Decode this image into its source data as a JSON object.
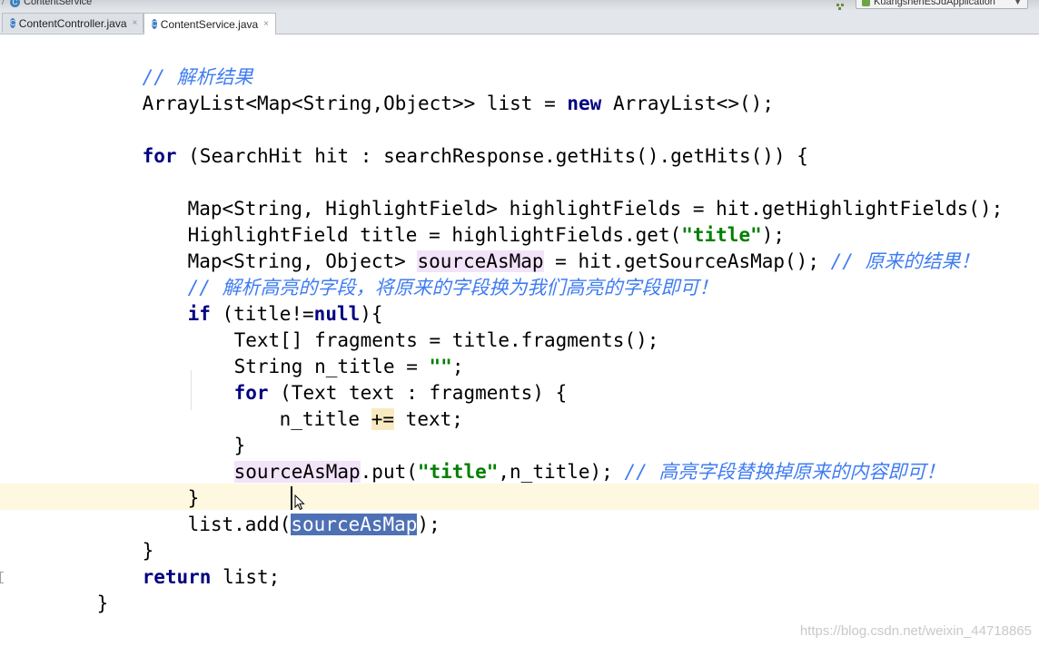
{
  "breadcrumb": {
    "items": [
      "ContentService"
    ],
    "run_config": "KuangshenEsJdApplication"
  },
  "tabs": [
    {
      "label": "ContentController.java",
      "active": false
    },
    {
      "label": "ContentService.java",
      "active": true
    }
  ],
  "code": {
    "lines": [
      [
        "// 解析结果"
      ],
      [
        "ArrayList<Map<String,Object>> list = ",
        "new",
        " ArrayList<>();"
      ],
      [
        ""
      ],
      [
        "for",
        " (SearchHit hit : searchResponse.getHits().getHits()) {"
      ],
      [
        ""
      ],
      [
        "Map<String, HighlightField> highlightFields = hit.getHighlightFields();"
      ],
      [
        "HighlightField title = highlightFields.get(",
        "\"title\"",
        ");"
      ],
      [
        "Map<String, Object> ",
        "sourceAsMap",
        " = hit.getSourceAsMap(); ",
        "// 原来的结果！"
      ],
      [
        "// 解析高亮的字段，将原来的字段换为我们高亮的字段即可！"
      ],
      [
        "if",
        " (title!=",
        "null",
        "){"
      ],
      [
        "Text[] fragments = title.fragments();"
      ],
      [
        "String n_title = ",
        "\"\"",
        ";"
      ],
      [
        "for",
        " (Text text : fragments) {"
      ],
      [
        "n_title ",
        "+=",
        " text;"
      ],
      [
        "}"
      ],
      [
        "sourceAsMap",
        ".put(",
        "\"title\"",
        ",n_title); ",
        "// 高亮字段替换掉原来的内容即可！"
      ],
      [
        "}"
      ],
      [
        "list.add(",
        "sourceAsMap",
        ");"
      ],
      [
        "}"
      ],
      [
        "return",
        " list;"
      ],
      [
        "}"
      ]
    ]
  },
  "colors": {
    "keyword": "#000080",
    "string": "#008000",
    "comment": "#3f7cf2",
    "selection": "#4e71b5",
    "caret_line": "#fdf8df"
  },
  "watermark": "https://blog.csdn.net/weixin_44718865"
}
